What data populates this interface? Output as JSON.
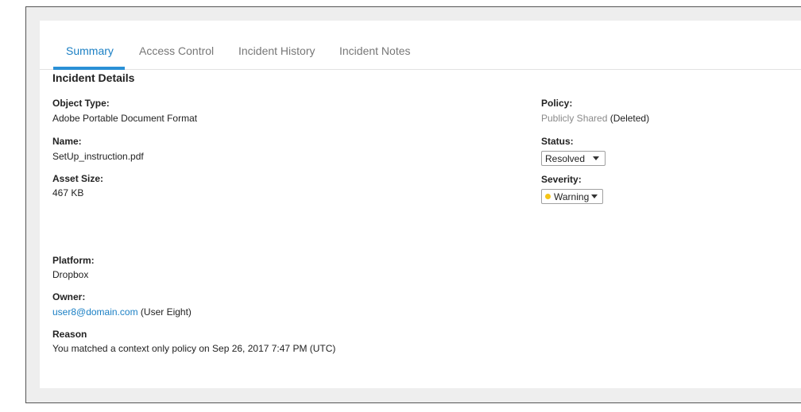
{
  "tabs": [
    {
      "label": "Summary"
    },
    {
      "label": "Access Control"
    },
    {
      "label": "Incident History"
    },
    {
      "label": "Incident Notes"
    }
  ],
  "section_title": "Incident Details",
  "details": {
    "object_type": {
      "label": "Object Type:",
      "value": "Adobe Portable Document Format"
    },
    "name": {
      "label": "Name:",
      "value": "SetUp_instruction.pdf"
    },
    "asset_size": {
      "label": "Asset Size:",
      "value": "467 KB"
    },
    "platform": {
      "label": "Platform:",
      "value": "Dropbox"
    },
    "owner": {
      "label": "Owner:",
      "email": "user8@domain.com",
      "display": "(User Eight)"
    },
    "reason": {
      "label": "Reason",
      "value": "You matched a context only policy on Sep 26, 2017 7:47 PM (UTC)"
    }
  },
  "right": {
    "policy": {
      "label": "Policy:",
      "name": "Publicly Shared",
      "note": "(Deleted)"
    },
    "status": {
      "label": "Status:",
      "selected": "Resolved"
    },
    "severity": {
      "label": "Severity:",
      "selected": "Warning",
      "dot_color": "#f5c518"
    }
  },
  "colors": {
    "accent": "#2a90d6",
    "link": "#1a7fc4"
  }
}
